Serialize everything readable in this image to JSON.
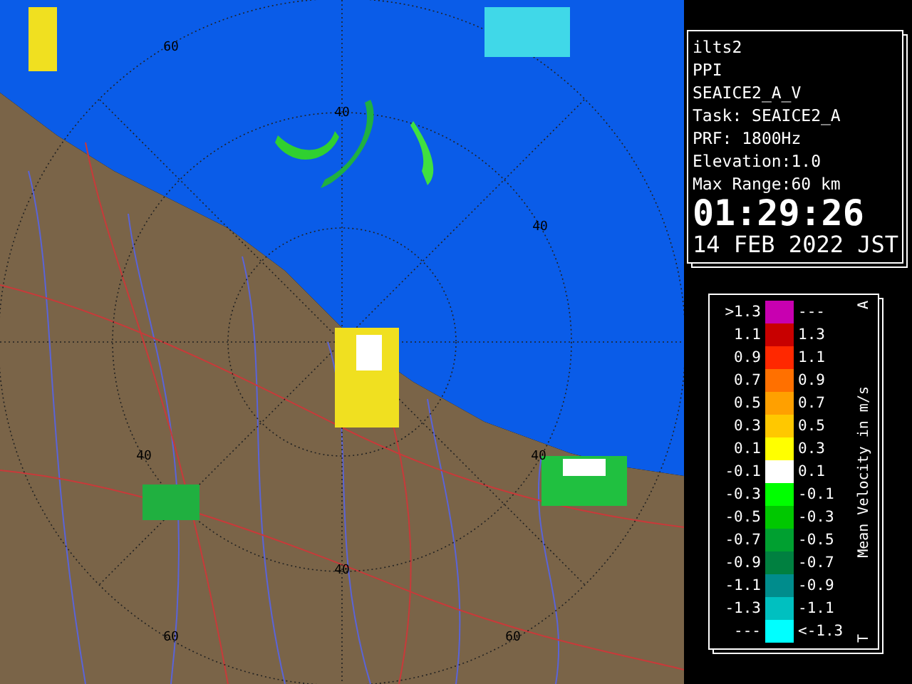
{
  "map": {
    "range_labels": [
      "60",
      "40",
      "40",
      "40",
      "40",
      "40",
      "60",
      "60"
    ]
  },
  "info": {
    "lines": [
      "ilts2",
      "PPI",
      "SEAICE2_A_V",
      "Task: SEAICE2_A",
      "PRF: 1800Hz",
      "Elevation:1.0",
      "Max Range:60 km"
    ],
    "time": "01:29:26",
    "date": "14 FEB 2022 JST"
  },
  "legend": {
    "title": "Mean Velocity in m/s",
    "top_mark": "A",
    "bottom_mark": "T",
    "rows": [
      {
        "low": ">1.3",
        "high": "---",
        "color": "#c800b0"
      },
      {
        "low": "1.1",
        "high": "1.3",
        "color": "#c80000"
      },
      {
        "low": "0.9",
        "high": "1.1",
        "color": "#ff2800"
      },
      {
        "low": "0.7",
        "high": "0.9",
        "color": "#ff7000"
      },
      {
        "low": "0.5",
        "high": "0.7",
        "color": "#ffa000"
      },
      {
        "low": "0.3",
        "high": "0.5",
        "color": "#ffc800"
      },
      {
        "low": "0.1",
        "high": "0.3",
        "color": "#ffff00"
      },
      {
        "low": "-0.1",
        "high": "0.1",
        "color": "#ffffff"
      },
      {
        "low": "-0.3",
        "high": "-0.1",
        "color": "#00ff00"
      },
      {
        "low": "-0.5",
        "high": "-0.3",
        "color": "#00c800"
      },
      {
        "low": "-0.7",
        "high": "-0.5",
        "color": "#00a030"
      },
      {
        "low": "-0.9",
        "high": "-0.7",
        "color": "#008040"
      },
      {
        "low": "-1.1",
        "high": "-0.9",
        "color": "#008c8c"
      },
      {
        "low": "-1.3",
        "high": "-1.1",
        "color": "#00c0c0"
      },
      {
        "low": "---",
        "high": "<-1.3",
        "color": "#00ffff"
      }
    ]
  }
}
